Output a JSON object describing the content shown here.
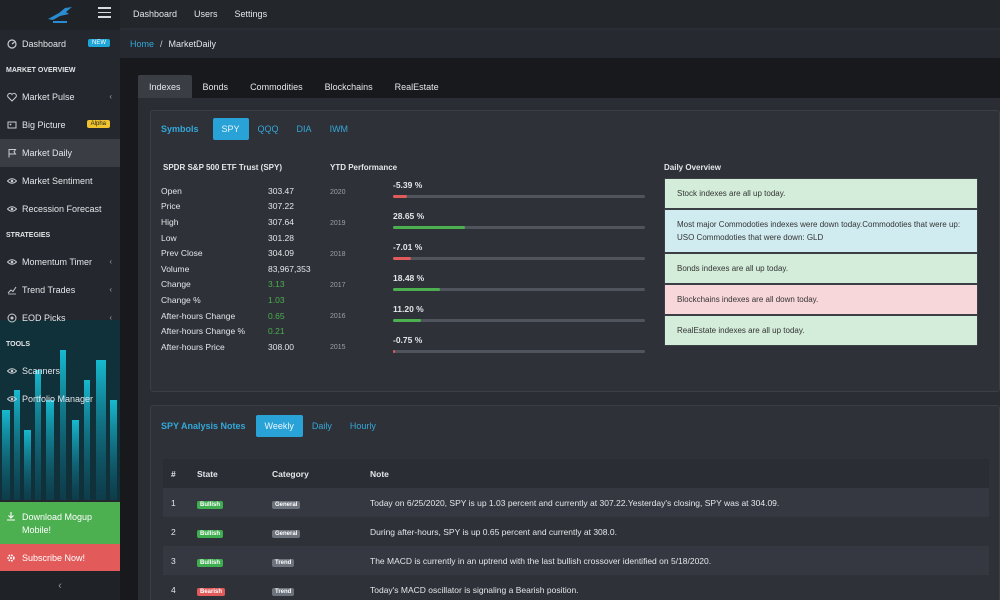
{
  "sidebar": {
    "items": [
      {
        "label": "Dashboard",
        "badge": "NEW",
        "icon": "dashboard-icon"
      },
      {
        "heading": "MARKET OVERVIEW"
      },
      {
        "label": "Market Pulse",
        "icon": "heart-icon",
        "chevron": true
      },
      {
        "label": "Big Picture",
        "badge": "Alpha",
        "icon": "picture-icon"
      },
      {
        "label": "Market Daily",
        "icon": "flag-icon",
        "active": true
      },
      {
        "label": "Market Sentiment",
        "icon": "eye-icon"
      },
      {
        "label": "Recession Forecast",
        "icon": "eye-icon"
      },
      {
        "heading": "STRATEGIES"
      },
      {
        "label": "Momentum Timer",
        "icon": "timer-icon",
        "chevron": true
      },
      {
        "label": "Trend Trades",
        "icon": "trend-icon",
        "chevron": true
      },
      {
        "label": "EOD Picks",
        "icon": "target-icon",
        "chevron": true
      },
      {
        "heading": "TOOLS"
      },
      {
        "label": "Scanners",
        "icon": "scan-icon"
      },
      {
        "label": "Portfolio Manager",
        "icon": "portfolio-icon"
      }
    ],
    "download_label": "Download Mogup Mobile!",
    "subscribe_label": "Subscribe Now!"
  },
  "topbar": {
    "links": [
      "Dashboard",
      "Users",
      "Settings"
    ]
  },
  "breadcrumb": {
    "home": "Home",
    "current": "MarketDaily"
  },
  "tabs": [
    "Indexes",
    "Bonds",
    "Commodities",
    "Blockchains",
    "RealEstate"
  ],
  "symbols": {
    "label": "Symbols",
    "items": [
      "SPY",
      "QQQ",
      "DIA",
      "IWM"
    ],
    "active": "SPY"
  },
  "quote": {
    "title": "SPDR S&P 500 ETF Trust (SPY)",
    "rows": [
      {
        "k": "Open",
        "v": "303.47",
        "green": false
      },
      {
        "k": "Price",
        "v": "307.22",
        "green": false
      },
      {
        "k": "High",
        "v": "307.64",
        "green": false
      },
      {
        "k": "Low",
        "v": "301.28",
        "green": false
      },
      {
        "k": "Prev Close",
        "v": "304.09",
        "green": false
      },
      {
        "k": "Volume",
        "v": "83,967,353",
        "green": false
      },
      {
        "k": "Change",
        "v": "3.13",
        "green": true
      },
      {
        "k": "Change %",
        "v": "1.03",
        "green": true
      },
      {
        "k": "After-hours Change",
        "v": "0.65",
        "green": true
      },
      {
        "k": "After-hours Change %",
        "v": "0.21",
        "green": true
      },
      {
        "k": "After-hours Price",
        "v": "308.00",
        "green": false
      }
    ]
  },
  "ytd": {
    "title": "YTD Performance",
    "rows": [
      {
        "year": "2020",
        "pct": "-5.39 %",
        "value": -5.39,
        "color": "#e35a5a"
      },
      {
        "year": "2019",
        "pct": "28.65 %",
        "value": 28.65,
        "color": "#4caf50"
      },
      {
        "year": "2018",
        "pct": "-7.01 %",
        "value": -7.01,
        "color": "#e35a5a"
      },
      {
        "year": "2017",
        "pct": "18.48 %",
        "value": 18.48,
        "color": "#4caf50"
      },
      {
        "year": "2016",
        "pct": "11.20 %",
        "value": 11.2,
        "color": "#4caf50"
      },
      {
        "year": "2015",
        "pct": "-0.75 %",
        "value": -0.75,
        "color": "#e35a5a"
      }
    ]
  },
  "overview": {
    "title": "Daily Overview",
    "items": [
      {
        "text": "Stock indexes are all up today.",
        "tone": "green"
      },
      {
        "text": "Most major Commodoties indexes were down today.Commodoties that were up: USO Commodoties that were down: GLD",
        "tone": "blue"
      },
      {
        "text": "Bonds indexes are all up today.",
        "tone": "green"
      },
      {
        "text": "Blockchains indexes are all down today.",
        "tone": "red"
      },
      {
        "text": "RealEstate indexes are all up today.",
        "tone": "green"
      }
    ]
  },
  "notes": {
    "label": "SPY Analysis Notes",
    "periods": [
      "Weekly",
      "Daily",
      "Hourly"
    ],
    "active": "Weekly",
    "headers": [
      "#",
      "State",
      "Category",
      "Note"
    ],
    "rows": [
      {
        "n": "1",
        "state": "Bullish",
        "cat": "General",
        "note": "Today on 6/25/2020, SPY is up 1.03 percent and currently at 307.22.Yesterday's closing, SPY was at 304.09."
      },
      {
        "n": "2",
        "state": "Bullish",
        "cat": "General",
        "note": "During after-hours, SPY is up 0.65 percent and currently at 308.0."
      },
      {
        "n": "3",
        "state": "Bullish",
        "cat": "Trend",
        "note": "The MACD is currently in an uptrend with the last bullish crossover identified on 5/18/2020."
      },
      {
        "n": "4",
        "state": "Bearish",
        "cat": "Trend",
        "note": "Today's MACD oscillator is signaling a Bearish position."
      }
    ]
  },
  "colors": {
    "accent": "#29a3d7",
    "success": "#4caf50",
    "danger": "#e35a5a",
    "warning": "#f0c22e"
  }
}
